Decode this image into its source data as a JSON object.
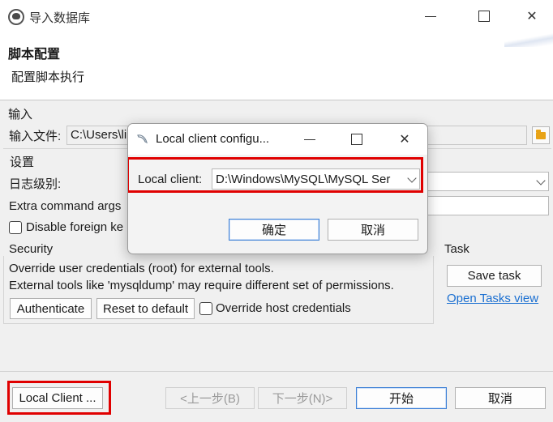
{
  "window": {
    "title": "导入数据库",
    "close_glyph": "✕"
  },
  "header": {
    "title": "脚本配置",
    "subtitle": "配置脚本执行"
  },
  "input_group": {
    "label": "输入",
    "file_label": "输入文件:",
    "file_value": "C:\\Users\\li"
  },
  "settings_group": {
    "label": "设置",
    "log_level_label": "日志级别:",
    "extra_args_label": "Extra command args",
    "disable_fk_label": "Disable foreign ke"
  },
  "security_group": {
    "label": "Security",
    "line1": "Override user credentials (root) for external tools.",
    "line2": "External tools like 'mysqldump' may require different set of permissions.",
    "authenticate_label": "Authenticate",
    "reset_label": "Reset to default",
    "override_host_label": "Override host credentials"
  },
  "task_group": {
    "label": "Task",
    "save_task_label": "Save task",
    "open_tasks_label": "Open Tasks view"
  },
  "footer": {
    "local_client_label": "Local Client ...",
    "prev_label": "<上一步(B)",
    "next_label": "下一步(N)>",
    "start_label": "开始",
    "cancel_label": "取消"
  },
  "dialog": {
    "title": "Local client configu...",
    "close_glyph": "✕",
    "local_client_label": "Local client:",
    "local_client_value": "D:\\Windows\\MySQL\\MySQL Ser",
    "ok_label": "确定",
    "cancel_label": "取消"
  },
  "colors": {
    "highlight_frame": "#e00000",
    "link": "#1a6fd1",
    "default_button_border": "#3c7fd6"
  }
}
